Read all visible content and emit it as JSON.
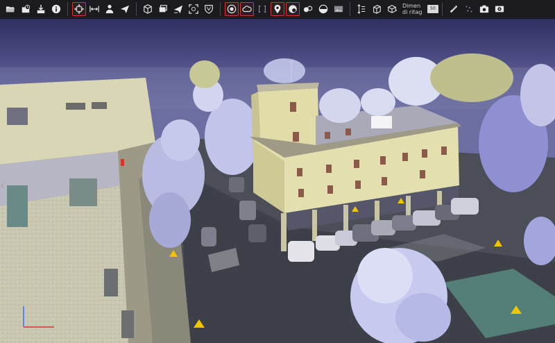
{
  "toolbar": {
    "groups": [
      {
        "buttons": [
          {
            "name": "open-folder",
            "icon": "folder-open-icon",
            "active": false
          },
          {
            "name": "open-recent",
            "icon": "folder-recent-icon",
            "active": false
          },
          {
            "name": "save-download",
            "icon": "download-icon",
            "active": false
          },
          {
            "name": "info",
            "icon": "info-icon",
            "active": false
          }
        ]
      },
      {
        "buttons": [
          {
            "name": "navigate-orbit",
            "icon": "crosshair-icon",
            "active": true
          },
          {
            "name": "fit-view",
            "icon": "fit-arrows-icon",
            "active": false
          },
          {
            "name": "walk-mode",
            "icon": "person-icon",
            "active": false
          },
          {
            "name": "fly-mode",
            "icon": "paper-plane-icon",
            "active": false
          }
        ]
      },
      {
        "buttons": [
          {
            "name": "cube-view",
            "icon": "cube-icon",
            "active": false
          },
          {
            "name": "layers",
            "icon": "layers-icon",
            "active": false
          },
          {
            "name": "send-view",
            "icon": "send-icon",
            "active": false
          },
          {
            "name": "zoom-extent",
            "icon": "zoom-frame-icon",
            "active": false
          },
          {
            "name": "shield",
            "icon": "shield-icon",
            "active": false
          }
        ]
      },
      {
        "buttons": [
          {
            "name": "target-circle",
            "icon": "target-icon",
            "active": true
          },
          {
            "name": "cloud-mode",
            "icon": "cloud-icon",
            "active": true
          },
          {
            "name": "clip-box",
            "icon": "clip-box-icon",
            "active": false
          },
          {
            "name": "location-pin",
            "icon": "location-pin-icon",
            "active": true
          },
          {
            "name": "color-rgb",
            "icon": "color-ball-icon",
            "active": true
          },
          {
            "name": "color-intensity",
            "icon": "droplets-icon",
            "active": false
          },
          {
            "name": "half-moon",
            "icon": "half-circle-icon",
            "active": false
          },
          {
            "name": "image-panel",
            "icon": "image-icon",
            "active": false
          }
        ]
      },
      {
        "buttons": [
          {
            "name": "height-measure",
            "icon": "height-icon",
            "active": false
          },
          {
            "name": "section-box",
            "icon": "section-icon",
            "active": false
          },
          {
            "name": "bounding-box",
            "icon": "box-3d-icon",
            "active": false
          }
        ],
        "crop": {
          "label": "Dimensione di ritaglio",
          "line1": "Dimen",
          "line2": "di ritag",
          "value": "50"
        }
      },
      {
        "buttons": [
          {
            "name": "measure-ruler",
            "icon": "ruler-icon",
            "active": false
          },
          {
            "name": "point-picker",
            "icon": "points-icon",
            "active": false
          },
          {
            "name": "screenshot",
            "icon": "camera-icon",
            "active": false
          },
          {
            "name": "record-video",
            "icon": "video-camera-icon",
            "active": false
          }
        ]
      }
    ]
  },
  "viewport": {
    "description": "point cloud scene",
    "sky_color": "#6c6ea1",
    "accent_red": "#d9342b",
    "axis_x_color": "#d9342b",
    "axis_y_color": "#3b6cff"
  }
}
